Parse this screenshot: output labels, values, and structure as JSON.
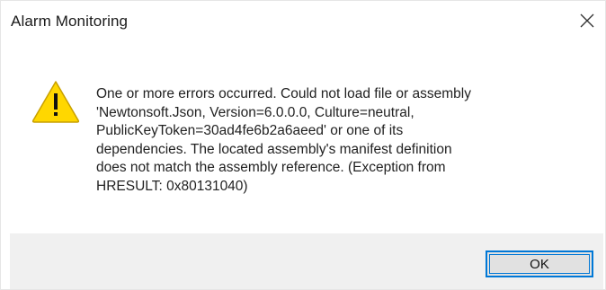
{
  "window": {
    "title": "Alarm Monitoring",
    "close_icon": "close-icon"
  },
  "message": {
    "icon": "warning-icon",
    "text": "One or more errors occurred. Could not load file or assembly\n'Newtonsoft.Json, Version=6.0.0.0, Culture=neutral,\nPublicKeyToken=30ad4fe6b2a6aeed' or one of its\ndependencies. The located assembly's manifest definition\ndoes not match the assembly reference. (Exception from\nHRESULT: 0x80131040)"
  },
  "buttons": {
    "ok_label": "OK"
  },
  "colors": {
    "warning_fill": "#ffd700",
    "warning_border": "#c8a000",
    "accent": "#0078d7",
    "footer_bg": "#f0f0f0"
  }
}
